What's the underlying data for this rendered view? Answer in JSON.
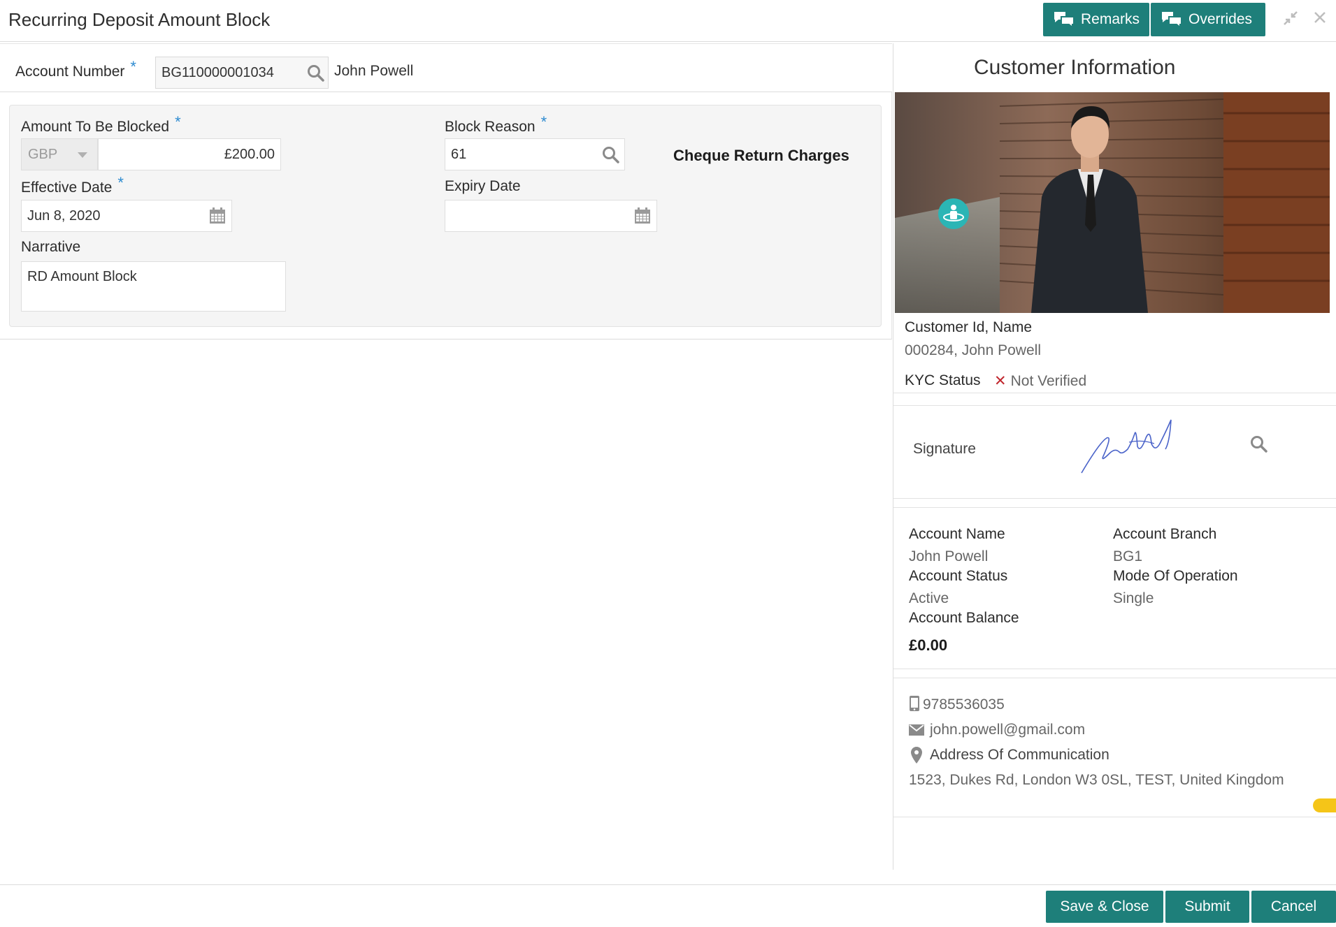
{
  "header": {
    "title": "Recurring Deposit Amount Block",
    "remarks_label": "Remarks",
    "overrides_label": "Overrides"
  },
  "account": {
    "label": "Account Number",
    "value": "BG110000001034",
    "name": "John Powell"
  },
  "form": {
    "amount_label": "Amount To Be Blocked",
    "currency": "GBP",
    "amount": "£200.00",
    "block_reason_label": "Block Reason",
    "block_reason": "61",
    "block_reason_desc": "Cheque Return Charges",
    "effective_date_label": "Effective Date",
    "effective_date": "Jun 8, 2020",
    "expiry_date_label": "Expiry Date",
    "expiry_date": "",
    "narrative_label": "Narrative",
    "narrative": "RD Amount Block",
    "required_mark": "*"
  },
  "customer": {
    "title": "Customer Information",
    "id_name_label": "Customer Id, Name",
    "id_name": "000284, John Powell",
    "kyc_label": "KYC Status",
    "kyc_value": "Not Verified",
    "signature_label": "Signature",
    "account_name_label": "Account Name",
    "account_name": "John Powell",
    "account_branch_label": "Account Branch",
    "account_branch": "BG1",
    "account_status_label": "Account Status",
    "account_status": "Active",
    "mode_label": "Mode Of Operation",
    "mode": "Single",
    "balance_label": "Account Balance",
    "balance": "£0.00",
    "phone": "9785536035",
    "email": "john.powell@gmail.com",
    "address_label": "Address Of Communication",
    "address": "1523, Dukes Rd, London W3 0SL, TEST, United Kingdom"
  },
  "footer": {
    "save_close": "Save & Close",
    "submit": "Submit",
    "cancel": "Cancel"
  },
  "colors": {
    "primary_button": "#1e7f7a",
    "required": "#2e8bd0",
    "kyc_error": "#c0262d"
  }
}
